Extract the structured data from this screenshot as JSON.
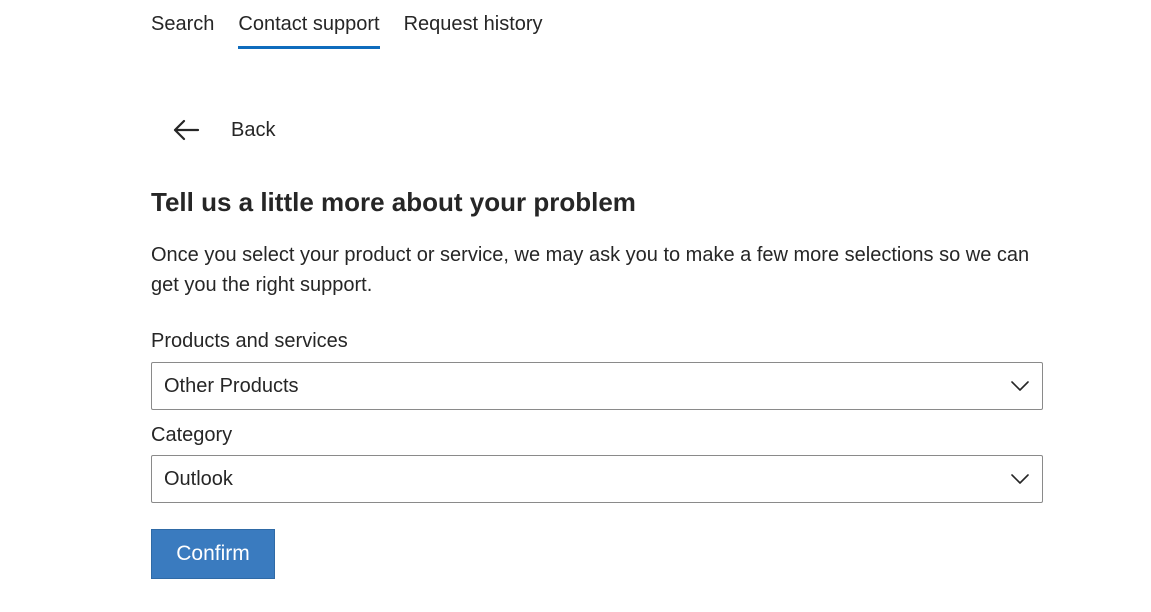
{
  "tabs": [
    {
      "label": "Search",
      "active": false
    },
    {
      "label": "Contact support",
      "active": true
    },
    {
      "label": "Request history",
      "active": false
    }
  ],
  "back": {
    "label": "Back",
    "icon": "arrow-left-icon"
  },
  "heading": "Tell us a little more about your problem",
  "description": "Once you select your product or service, we may ask you to make a few more selections so we can get you the right support.",
  "products": {
    "label": "Products and services",
    "value": "Other Products",
    "icon": "chevron-down-icon"
  },
  "category": {
    "label": "Category",
    "value": "Outlook",
    "icon": "chevron-down-icon"
  },
  "confirm_label": "Confirm",
  "colors": {
    "accent": "#0f6cbd",
    "button_bg": "#3a7bbf",
    "text": "#262626",
    "border": "#8a8a8a"
  }
}
